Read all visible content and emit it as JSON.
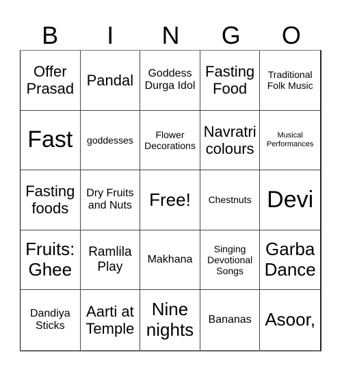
{
  "header": {
    "letters": [
      "B",
      "I",
      "N",
      "G",
      "O"
    ]
  },
  "cells": [
    {
      "text": "Offer Prasad",
      "size": "s-xl"
    },
    {
      "text": "Pandal",
      "size": "s-xl"
    },
    {
      "text": "Goddess Durga Idol",
      "size": "s-md"
    },
    {
      "text": "Fasting Food",
      "size": "s-xl"
    },
    {
      "text": "Traditional Folk Music",
      "size": "s-sm"
    },
    {
      "text": "Fast",
      "size": "s-huge"
    },
    {
      "text": "goddesses",
      "size": "s-sm"
    },
    {
      "text": "Flower Decorations",
      "size": "s-sm"
    },
    {
      "text": "Navratri colours",
      "size": "s-xl"
    },
    {
      "text": "Musical Performances",
      "size": "s-xs"
    },
    {
      "text": "Fasting foods",
      "size": "s-xl"
    },
    {
      "text": "Dry Fruits and Nuts",
      "size": "s-md"
    },
    {
      "text": "Free!",
      "size": "s-xxl"
    },
    {
      "text": "Chestnuts",
      "size": "s-sm"
    },
    {
      "text": "Devi",
      "size": "s-huge"
    },
    {
      "text": "Fruits: Ghee",
      "size": "s-xxl"
    },
    {
      "text": "Ramlila Play",
      "size": "s-lg"
    },
    {
      "text": "Makhana",
      "size": "s-md"
    },
    {
      "text": "Singing Devotional Songs",
      "size": "s-sm"
    },
    {
      "text": "Garba Dance",
      "size": "s-xxl"
    },
    {
      "text": "Dandiya Sticks",
      "size": "s-md"
    },
    {
      "text": "Aarti at Temple",
      "size": "s-xl"
    },
    {
      "text": "Nine nights",
      "size": "s-xxl"
    },
    {
      "text": "Bananas",
      "size": "s-md"
    },
    {
      "text": "Asoor,",
      "size": "s-xxl"
    }
  ]
}
